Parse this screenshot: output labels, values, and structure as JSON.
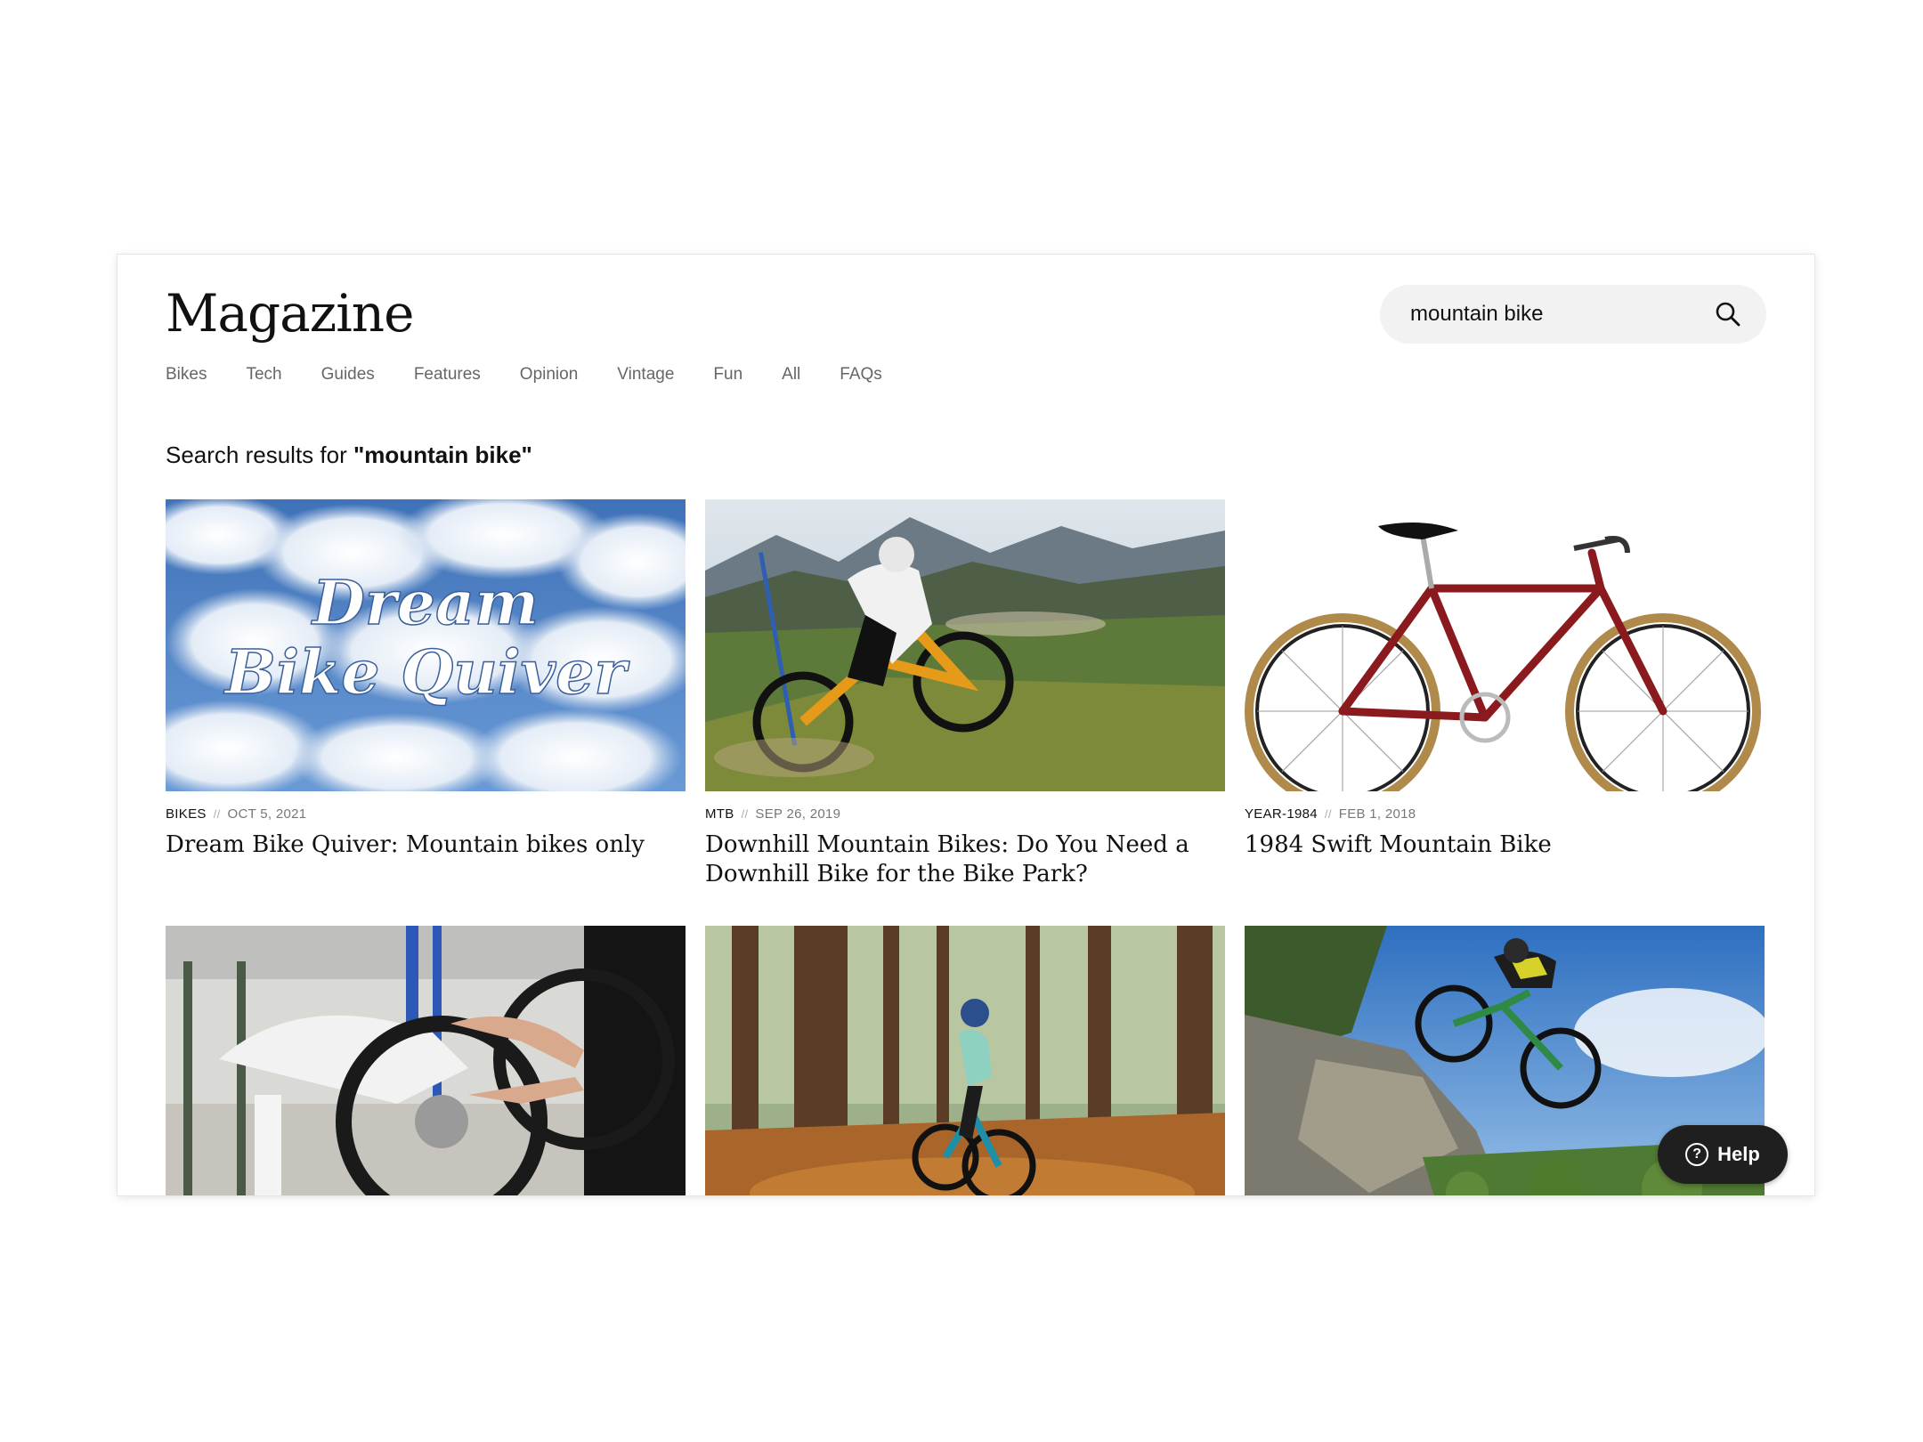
{
  "header": {
    "logo": "Magazine",
    "search": {
      "value": "mountain bike",
      "icon": "search-icon"
    }
  },
  "nav": [
    "Bikes",
    "Tech",
    "Guides",
    "Features",
    "Opinion",
    "Vintage",
    "Fun",
    "All",
    "FAQs"
  ],
  "results": {
    "prefix": "Search results for ",
    "query": "\"mountain bike\""
  },
  "articles": [
    {
      "category": "BIKES",
      "date": "OCT 5, 2021",
      "title": "Dream Bike Quiver: Mountain bikes only",
      "image_text": [
        "Dream",
        "Bike Quiver"
      ]
    },
    {
      "category": "MTB",
      "date": "SEP 26, 2019",
      "title": "Downhill Mountain Bikes: Do You Need a Downhill Bike for the Bike Park?"
    },
    {
      "category": "YEAR-1984",
      "date": "FEB 1, 2018",
      "title": "1984 Swift Mountain Bike"
    },
    {
      "category": "",
      "date": "",
      "title": ""
    },
    {
      "category": "",
      "date": "",
      "title": ""
    },
    {
      "category": "",
      "date": "",
      "title": ""
    }
  ],
  "meta_separator": "//",
  "help": {
    "label": "Help",
    "icon": "question-circle-icon"
  },
  "colors": {
    "accent": "#1f1f1f",
    "search_bg": "#f2f2f2",
    "bike_red": "#8b1a1f"
  }
}
